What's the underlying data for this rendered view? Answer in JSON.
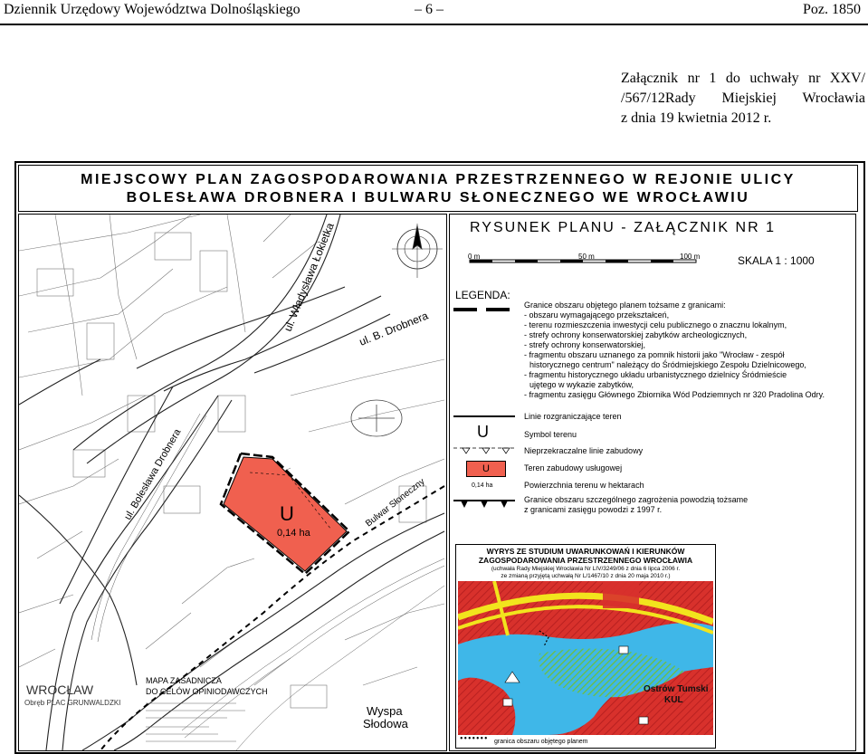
{
  "header": {
    "journal": "Dziennik Urzędowy Województwa Dolnośląskiego",
    "page": "– 6 –",
    "position": "Poz. 1850"
  },
  "annex": {
    "line1": "Załącznik nr 1 do uchwały nr XXV/",
    "line2": "/567/12Rady Miejskiej Wrocławia",
    "line3": "z dnia 19 kwietnia 2012 r."
  },
  "plan": {
    "title_line1": "MIEJSCOWY PLAN ZAGOSPODAROWANIA PRZESTRZENNEGO W REJONIE ULICY",
    "title_line2": "BOLESŁAWA DROBNERA I BULWARU SŁONECZNEGO WE WROCŁAWIU",
    "drawing_title": "RYSUNEK PLANU - ZAŁĄCZNIK NR 1",
    "scale_label": "SKALA 1 : 1000",
    "scale_ticks": [
      "0 m",
      "50 m",
      "100 m"
    ],
    "north": "N"
  },
  "map": {
    "streets": {
      "lokietka": "ul. Władysława Łokietka",
      "drobnera_top": "ul. B. Drobnera",
      "drobnera_left": "ul. Bolesława Drobnera",
      "bulwar": "Bulwar Słoneczny"
    },
    "zone_symbol": "U",
    "zone_area": "0,14 ha",
    "city": "WROCŁAW",
    "district": "Obręb PLAC GRUNWALDZKI",
    "base_map_title1": "MAPA ZASADNICZA",
    "base_map_title2": "DO CELÓW OPINIODAWCZYCH",
    "island1": "Wyspa",
    "island2": "Słodowa"
  },
  "legend": {
    "heading": "LEGENDA:",
    "boundary_lines": [
      "Granice obszaru objętego planem tożsame z granicami:",
      "- obszaru wymagającego przekształceń,",
      "- terenu rozmieszczenia inwestycji celu publicznego o znacznu lokalnym,",
      "- strefy ochrony konserwatorskiej zabytków archeologicznych,",
      "- strefy ochrony konserwatorskiej,",
      "- fragmentu obszaru uznanego za pomnik historii jako \"Wrocław - zespół",
      "historycznego centrum\" należący do Śródmiejskiego Zespołu Dzielnicowego,",
      "- fragmentu historycznego układu urbanistycznego dzielnicy Śródmieście",
      "ujętego w wykazie zabytków,",
      "- fragmentu zasięgu Głównego Zbiornika Wód Podziemnych nr 320 Pradolina Odry."
    ],
    "items": {
      "dividing_lines": "Linie rozgraniczające teren",
      "terrain_symbol": "Symbol terenu",
      "building_lines": "Nieprzekraczalne linie zabudowy",
      "service_area": "Teren zabudowy usługowej",
      "area_hectares": "Powierzchnia terenu w hektarach",
      "flood_line1": "Granice obszaru szczególnego zagrożenia powodzią tożsame",
      "flood_line2": "z granicami zasięgu powodzi z 1997 r."
    },
    "sample_symbol": "U",
    "sample_area": "0,14 ha"
  },
  "study": {
    "title1": "WYRYS ZE STUDIUM UWARUNKOWAŃ I KIERUNKÓW",
    "title2": "ZAGOSPODAROWANIA PRZESTRZENNEGO WROCŁAWIA",
    "note1": "(uchwała Rady Miejskiej Wrocławia Nr LIV/3249/06 z dnia 6 lipca 2006 r.",
    "note2": "ze zmianą przyjętą uchwałą Nr L/1467/10 z dnia 20 maja 2010 r.)",
    "place1": "Ostrów Tumski",
    "place2": "KUL",
    "footer_legend": "granica obszaru objętego planem"
  },
  "colors": {
    "zone_red": "#f0604f",
    "river_blue": "#3fb7e8",
    "study_red": "#d8312c",
    "green_hatch": "#6fbf3a",
    "yellow_band": "#f2e41d"
  }
}
